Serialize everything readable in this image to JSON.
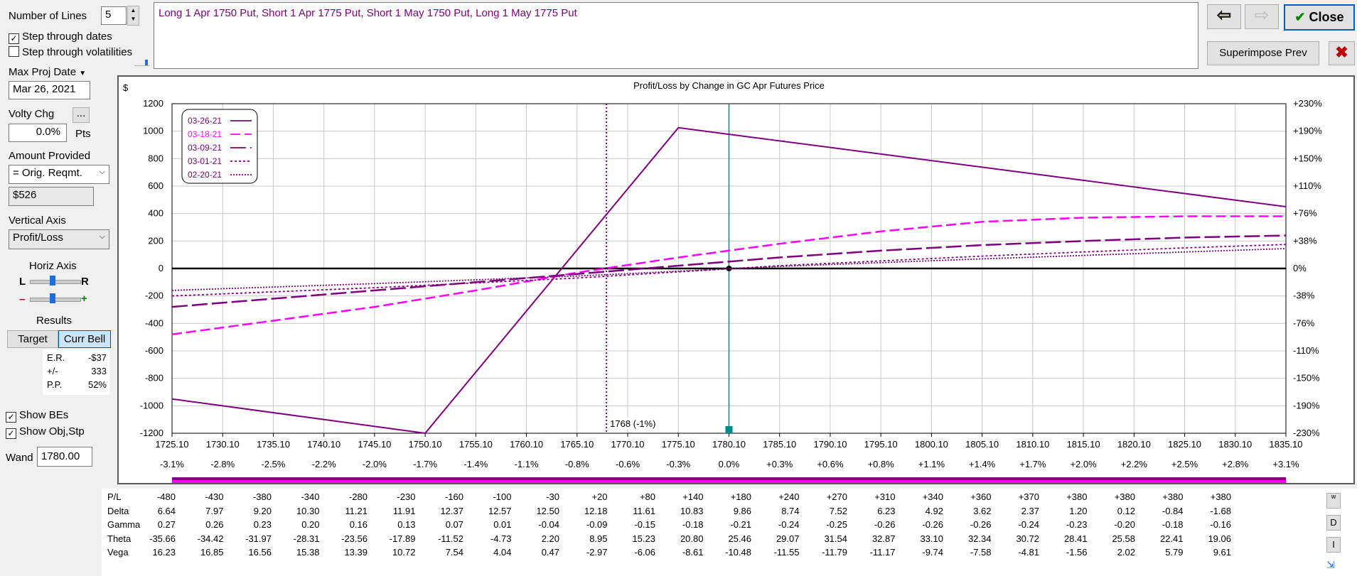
{
  "controls": {
    "num_lines_label": "Number of Lines",
    "num_lines_value": "5",
    "step_dates_label": "Step through dates",
    "step_dates_checked": true,
    "step_vols_label": "Step through volatilities",
    "step_vols_checked": false,
    "max_proj_date_label": "Max Proj Date",
    "max_proj_date_value": "Mar 26, 2021",
    "volty_chg_label": "Volty Chg",
    "volty_more_button": "...",
    "volty_value": "0.0%",
    "volty_unit": "Pts",
    "amount_provided_label": "Amount Provided",
    "amount_provided_value": "= Orig. Reqmt.",
    "amount_value": "$526",
    "vertical_axis_label": "Vertical Axis",
    "vertical_axis_value": "Profit/Loss",
    "horiz_axis_label": "Horiz Axis",
    "horiz_l": "L",
    "horiz_r": "R",
    "minus": "–",
    "plus": "+",
    "results_label": "Results",
    "target_button": "Target",
    "curr_bell_button": "Curr Bell",
    "results": [
      {
        "label": "E.R.",
        "value": "-$37"
      },
      {
        "label": "+/-",
        "value": "333"
      },
      {
        "label": "P.P.",
        "value": "52%"
      }
    ],
    "show_bes_label": "Show BEs",
    "show_bes_checked": true,
    "show_obj_label": "Show Obj,Stp",
    "show_obj_checked": true,
    "wand_label": "Wand",
    "wand_value": "1780.00"
  },
  "strategy_text": "Long 1 Apr 1750 Put, Short 1 Apr 1775 Put, Short 1 May 1750 Put, Long 1 May 1775 Put",
  "toolbar": {
    "close_label": "Close",
    "superimpose_label": "Superimpose Prev"
  },
  "chart_data": {
    "type": "line",
    "title": "Profit/Loss by Change in GC Apr Futures Price",
    "ylabel": "$",
    "ylim": [
      -1200,
      1200
    ],
    "xlim": [
      1725.1,
      1835.1
    ],
    "x_ticks": [
      "1725.10",
      "1730.10",
      "1735.10",
      "1740.10",
      "1745.10",
      "1750.10",
      "1755.10",
      "1760.10",
      "1765.10",
      "1770.10",
      "1775.10",
      "1780.10",
      "1785.10",
      "1790.10",
      "1795.10",
      "1800.10",
      "1805.10",
      "1810.10",
      "1815.10",
      "1820.10",
      "1825.10",
      "1830.10",
      "1835.10"
    ],
    "x_pct_ticks": [
      "-3.1%",
      "-2.8%",
      "-2.5%",
      "-2.2%",
      "-2.0%",
      "-1.7%",
      "-1.4%",
      "-1.1%",
      "-0.8%",
      "-0.6%",
      "-0.3%",
      "0.0%",
      "+0.3%",
      "+0.6%",
      "+0.8%",
      "+1.1%",
      "+1.4%",
      "+1.7%",
      "+2.0%",
      "+2.2%",
      "+2.5%",
      "+2.8%",
      "+3.1%"
    ],
    "y_ticks": [
      "1200",
      "1000",
      "800",
      "600",
      "400",
      "200",
      "0",
      "-200",
      "-400",
      "-600",
      "-800",
      "-1000",
      "-1200"
    ],
    "y_right_ticks": [
      "+230%",
      "+190%",
      "+150%",
      "+110%",
      "+76%",
      "+38%",
      "0%",
      "-38%",
      "-76%",
      "-110%",
      "-150%",
      "-190%",
      "-230%"
    ],
    "grid": true,
    "legend_position": "top-left",
    "current_price": 1780.1,
    "breakeven_marker": {
      "x": 1768,
      "label": "1768 (-1%)"
    },
    "series": [
      {
        "name": "03-26-21",
        "color": "#800080",
        "style": "solid",
        "x": [
          1725.1,
          1750.1,
          1775.1,
          1835.1
        ],
        "y": [
          -950,
          -1200,
          1025,
          450
        ]
      },
      {
        "name": "03-18-21",
        "color": "#ff00ff",
        "style": "dash",
        "x": [
          1725.1,
          1735.1,
          1745.1,
          1755.1,
          1765.1,
          1775.1,
          1785.1,
          1795.1,
          1805.1,
          1815.1,
          1825.1,
          1835.1
        ],
        "y": [
          -480,
          -380,
          -280,
          -160,
          -30,
          80,
          180,
          270,
          340,
          370,
          380,
          380
        ]
      },
      {
        "name": "03-09-21",
        "color": "#800080",
        "style": "longdash",
        "x": [
          1725.1,
          1735.1,
          1745.1,
          1755.1,
          1765.1,
          1775.1,
          1785.1,
          1795.1,
          1805.1,
          1815.1,
          1825.1,
          1835.1
        ],
        "y": [
          -280,
          -220,
          -160,
          -100,
          -40,
          20,
          80,
          130,
          170,
          200,
          225,
          240
        ]
      },
      {
        "name": "03-01-21",
        "color": "#800080",
        "style": "dot",
        "x": [
          1725.1,
          1745.1,
          1765.1,
          1785.1,
          1805.1,
          1825.1,
          1835.1
        ],
        "y": [
          -200,
          -140,
          -70,
          20,
          90,
          150,
          175
        ]
      },
      {
        "name": "02-20-21",
        "color": "#800080",
        "style": "dot2",
        "x": [
          1725.1,
          1745.1,
          1765.1,
          1785.1,
          1805.1,
          1825.1,
          1835.1
        ],
        "y": [
          -160,
          -110,
          -55,
          15,
          70,
          120,
          145
        ]
      }
    ]
  },
  "greeks": {
    "rows": [
      {
        "name": "P/L",
        "values": [
          "-480",
          "-430",
          "-380",
          "-340",
          "-280",
          "-230",
          "-160",
          "-100",
          "-30",
          "+20",
          "+80",
          "+140",
          "+180",
          "+240",
          "+270",
          "+310",
          "+340",
          "+360",
          "+370",
          "+380",
          "+380",
          "+380",
          "+380"
        ]
      },
      {
        "name": "Delta",
        "values": [
          "6.64",
          "7.97",
          "9.20",
          "10.30",
          "11.21",
          "11.91",
          "12.37",
          "12.57",
          "12.50",
          "12.18",
          "11.61",
          "10.83",
          "9.86",
          "8.74",
          "7.52",
          "6.23",
          "4.92",
          "3.62",
          "2.37",
          "1.20",
          "0.12",
          "-0.84",
          "-1.68"
        ]
      },
      {
        "name": "Gamma",
        "values": [
          "0.27",
          "0.26",
          "0.23",
          "0.20",
          "0.16",
          "0.13",
          "0.07",
          "0.01",
          "-0.04",
          "-0.09",
          "-0.15",
          "-0.18",
          "-0.21",
          "-0.24",
          "-0.25",
          "-0.26",
          "-0.26",
          "-0.26",
          "-0.24",
          "-0.23",
          "-0.20",
          "-0.18",
          "-0.16"
        ]
      },
      {
        "name": "Theta",
        "values": [
          "-35.66",
          "-34.42",
          "-31.97",
          "-28.31",
          "-23.56",
          "-17.89",
          "-11.52",
          "-4.73",
          "2.20",
          "8.95",
          "15.23",
          "20.80",
          "25.46",
          "29.07",
          "31.54",
          "32.87",
          "33.10",
          "32.34",
          "30.72",
          "28.41",
          "25.58",
          "22.41",
          "19.06"
        ]
      },
      {
        "name": "Vega",
        "values": [
          "16.23",
          "16.85",
          "16.56",
          "15.38",
          "13.39",
          "10.72",
          "7.54",
          "4.04",
          "0.47",
          "-2.97",
          "-6.06",
          "-8.61",
          "-10.48",
          "-11.55",
          "-11.79",
          "-11.17",
          "-9.74",
          "-7.58",
          "-4.81",
          "-1.56",
          "2.02",
          "5.79",
          "9.61"
        ]
      }
    ],
    "side_buttons": [
      "w",
      "D",
      "I"
    ]
  }
}
